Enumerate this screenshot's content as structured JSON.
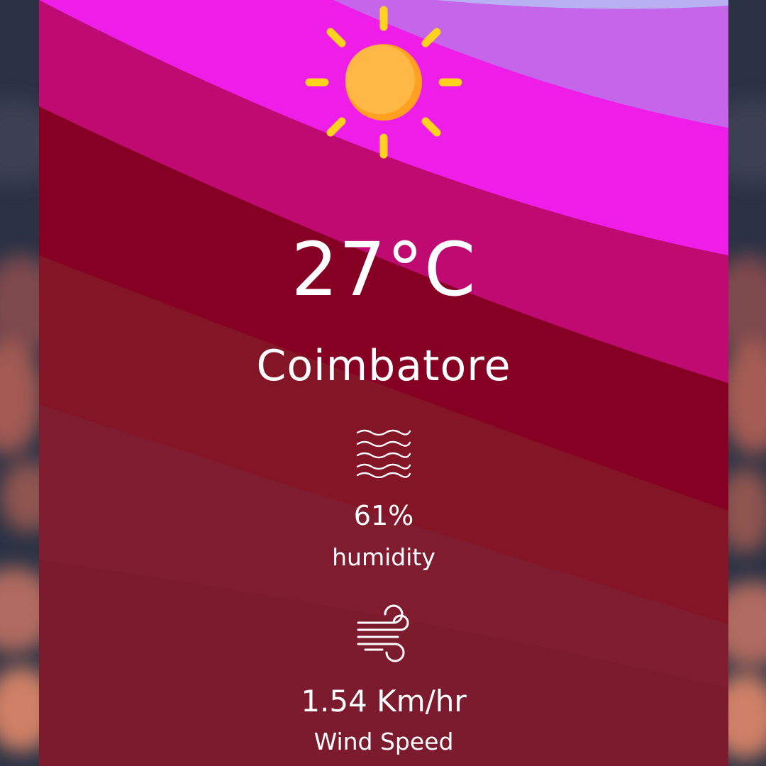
{
  "weather": {
    "temperature": "27°C",
    "city": "Coimbatore",
    "condition_icon": "sun-icon",
    "humidity": {
      "value": "61%",
      "label": "humidity",
      "icon": "humidity-waves-icon"
    },
    "wind": {
      "value": "1.54 Km/hr",
      "label": "Wind Speed",
      "icon": "wind-icon"
    }
  },
  "colors": {
    "text": "#ffffff",
    "sun_body": "#ffb845",
    "sun_rays": "#ffd21f",
    "band_lavender": "#c566ea",
    "band_magenta": "#ee1ee8",
    "band_pink": "#bf0a71",
    "band_crimson": "#850022",
    "band_deep_red": "#7a1530"
  }
}
